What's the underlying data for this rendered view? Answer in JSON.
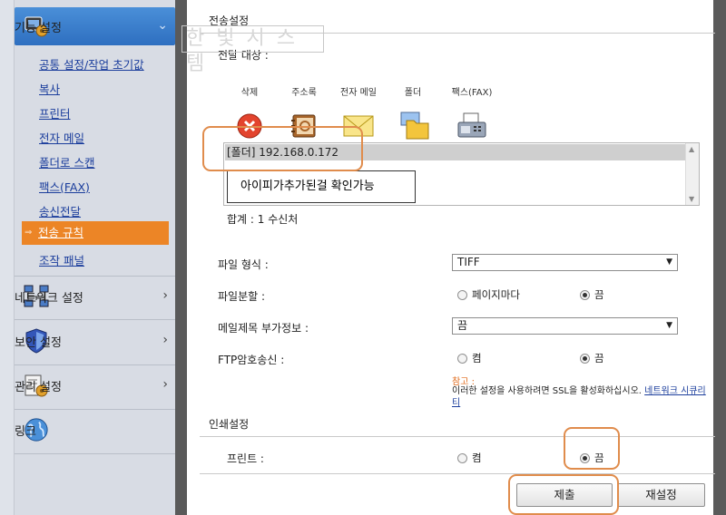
{
  "watermark": "한 빛 시 스 템",
  "sidebar": {
    "sections": [
      {
        "label": "기능 설정",
        "icon": "function-settings-icon"
      },
      {
        "label": "네트워크 설정",
        "icon": "network-icon"
      },
      {
        "label": "보안 설정",
        "icon": "shield-icon"
      },
      {
        "label": "관리 설정",
        "icon": "management-icon"
      },
      {
        "label": "링크",
        "icon": "globe-icon"
      }
    ],
    "items": [
      {
        "label": "공통 설정/작업 초기값"
      },
      {
        "label": "복사"
      },
      {
        "label": "프린터"
      },
      {
        "label": "전자 메일"
      },
      {
        "label": "폴더로 스캔"
      },
      {
        "label": "팩스(FAX)"
      },
      {
        "label": "송신전달"
      },
      {
        "label": "전송 규칙"
      },
      {
        "label": "조작 패널"
      }
    ]
  },
  "transfer": {
    "section_title": "전송설정",
    "dest_label": "전달 대상 :",
    "destinations": [
      {
        "label": "삭제",
        "icon": "delete-icon"
      },
      {
        "label": "주소록",
        "icon": "address-book-icon"
      },
      {
        "label": "전자 메일",
        "icon": "email-icon"
      },
      {
        "label": "폴더",
        "icon": "folder-icon"
      },
      {
        "label": "팩스(FAX)",
        "icon": "fax-icon"
      }
    ],
    "list_entry": "[폴더] 192.168.0.172",
    "note": "아이피가추가된걸 확인가능",
    "total": "합계 : 1 수신처",
    "file_format_label": "파일 형식 :",
    "file_format_value": "TIFF",
    "file_split_label": "파일분할 :",
    "file_split_options": [
      "페이지마다",
      "끔"
    ],
    "mail_subject_label": "메일제목 부가정보 :",
    "mail_subject_value": "끔",
    "ftp_label": "FTP암호송신 :",
    "ftp_options": [
      "켬",
      "끔"
    ],
    "ref_title": "참고 :",
    "ref_text": "이러한 설정을 사용하려면 SSL을 활성화하십시오.",
    "ref_link": "네트워크 시큐리티"
  },
  "print": {
    "section_title": "인쇄설정",
    "print_label": "프린트 :",
    "print_options": [
      "켬",
      "끔"
    ]
  },
  "buttons": {
    "submit": "제출",
    "reset": "재설정"
  },
  "colors": {
    "active_item": "#ec8526",
    "active_section": "#2e6fc0",
    "annotation_ring": "#e08c4c"
  }
}
